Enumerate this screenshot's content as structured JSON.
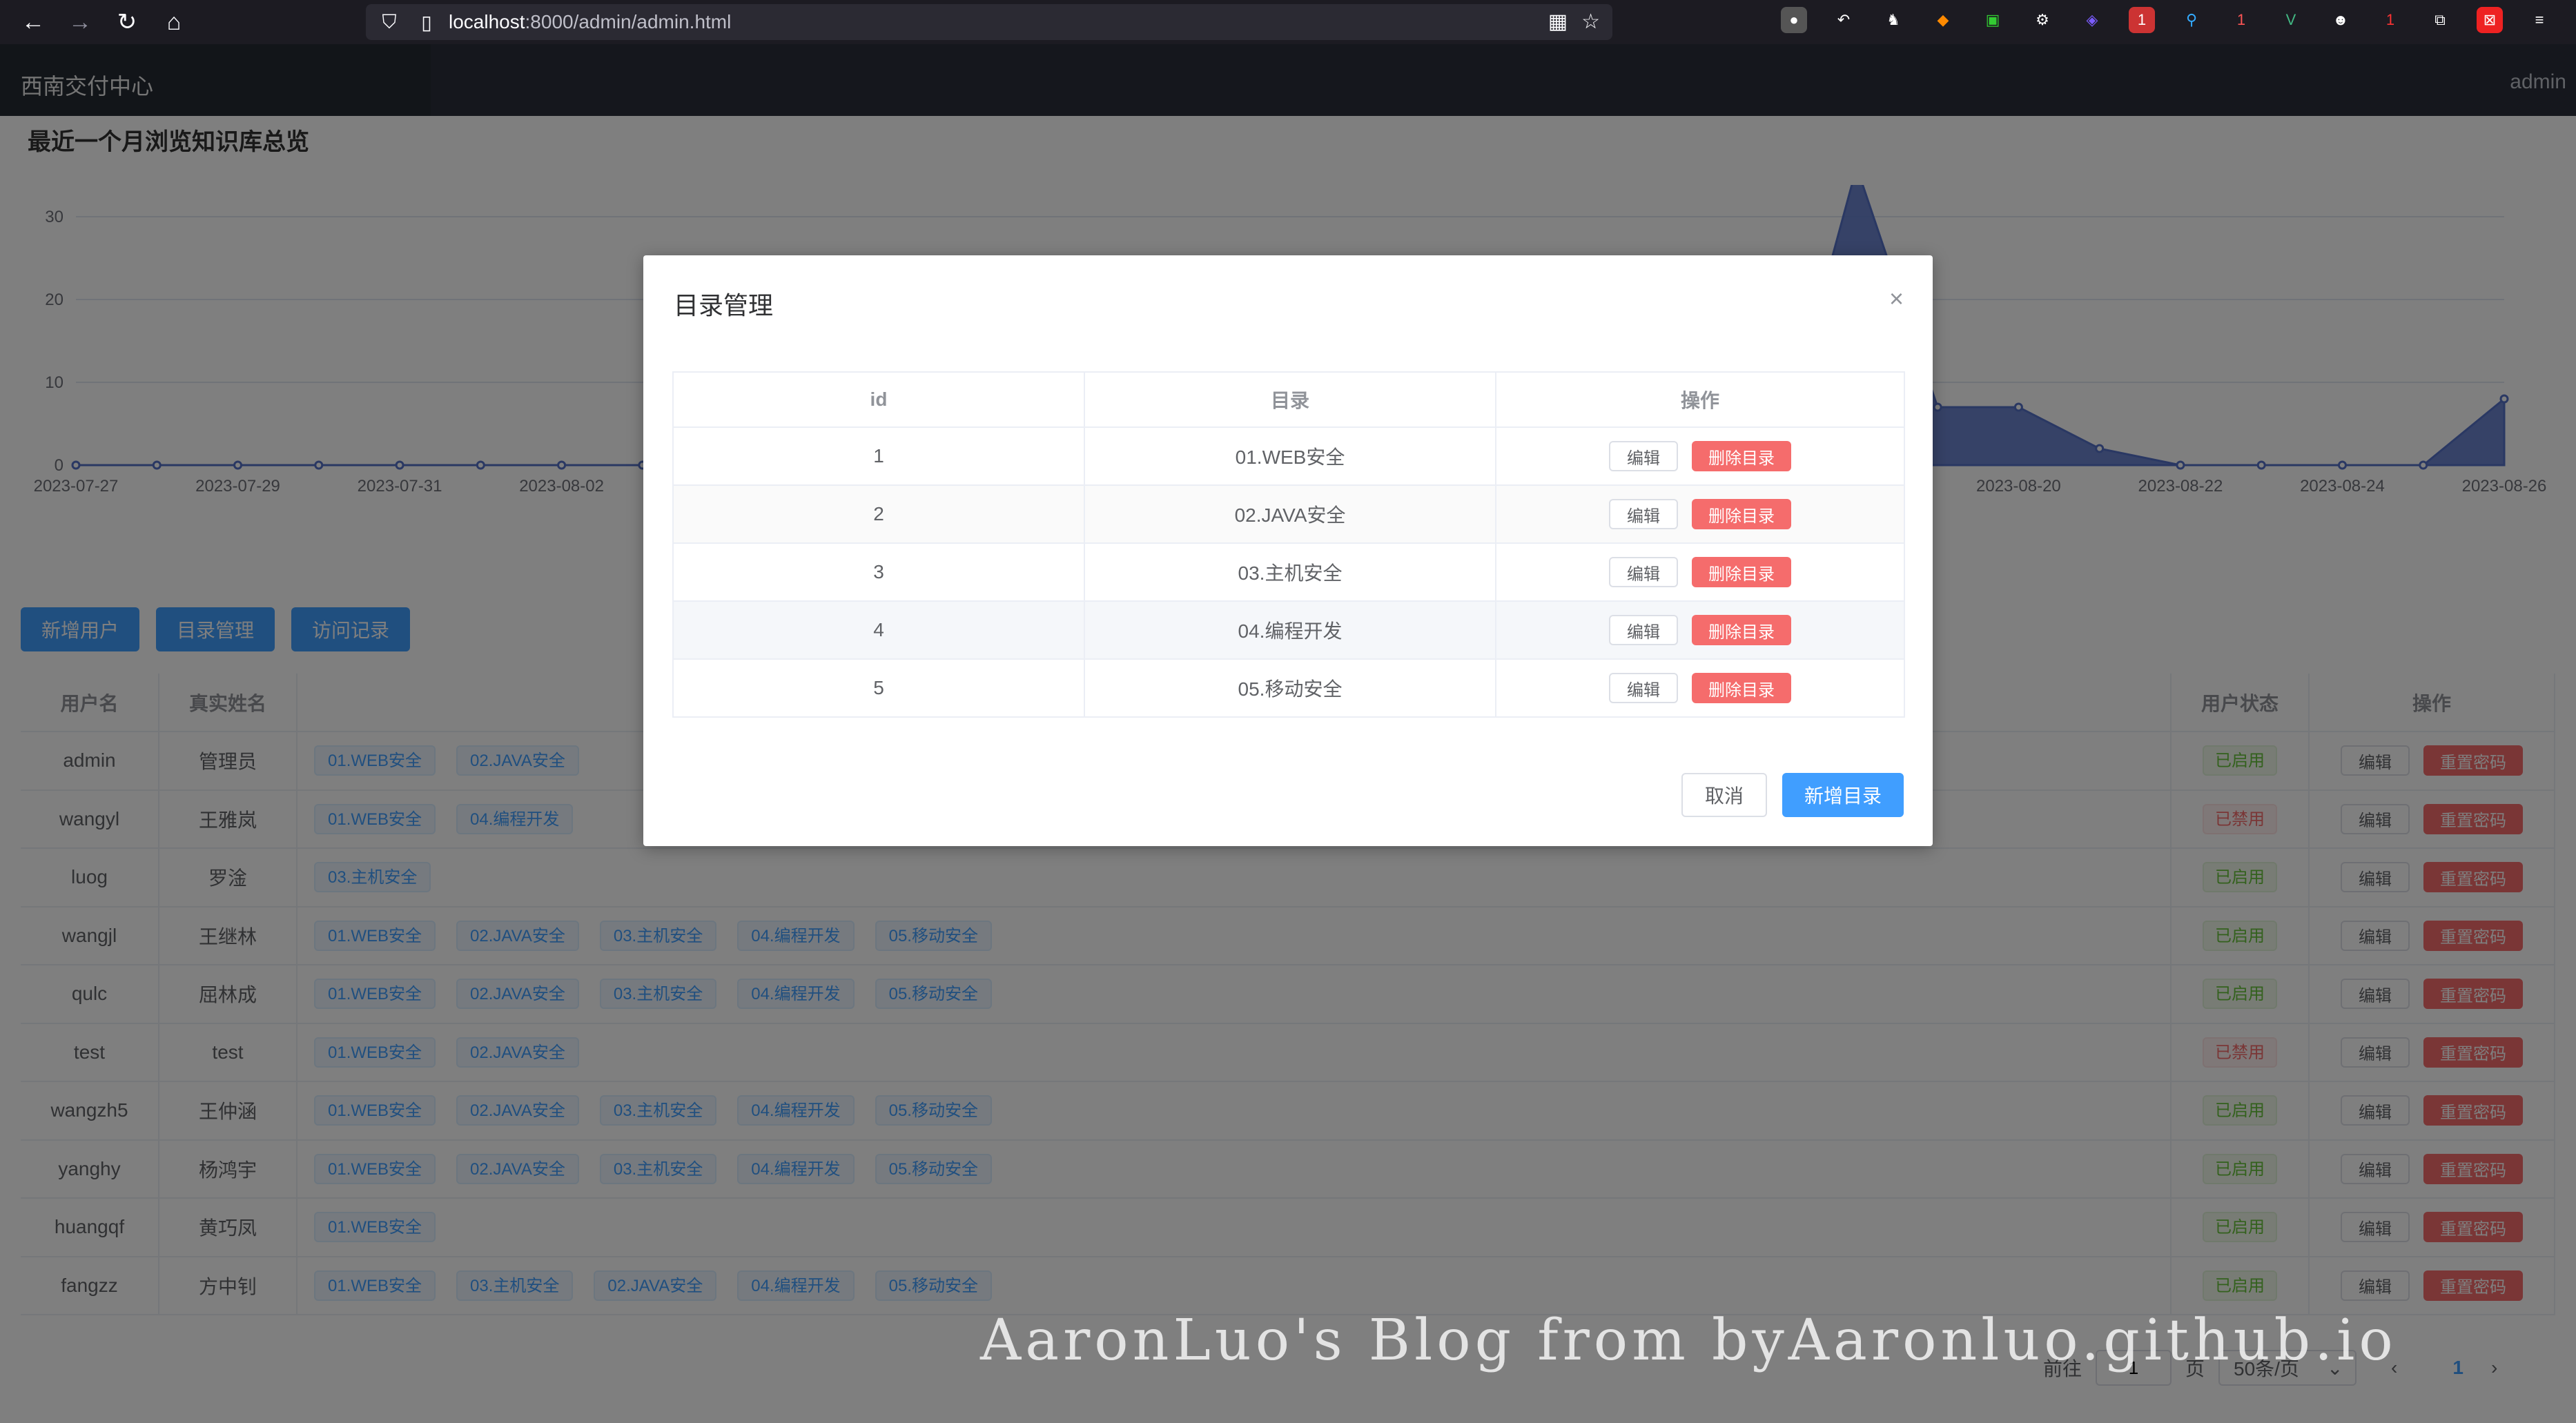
{
  "browser": {
    "url_host": "localhost",
    "url_rest": ":8000/admin/admin.html",
    "extension_badges": [
      "1",
      "1",
      "1"
    ]
  },
  "app": {
    "brand": "西南交付中心",
    "user": "admin"
  },
  "chart_data": {
    "type": "area",
    "title": "最近一个月浏览知识库总览",
    "ylim": [
      0,
      40
    ],
    "yticks": [
      "0",
      "10",
      "20",
      "30",
      "40"
    ],
    "x": [
      "2023-07-27",
      "2023-07-28",
      "2023-07-29",
      "2023-07-30",
      "2023-07-31",
      "2023-08-01",
      "2023-08-02",
      "2023-08-03",
      "2023-08-04",
      "2023-08-05",
      "2023-08-06",
      "2023-08-07",
      "2023-08-08",
      "2023-08-09",
      "2023-08-10",
      "2023-08-11",
      "2023-08-12",
      "2023-08-13",
      "2023-08-14",
      "2023-08-15",
      "2023-08-16",
      "2023-08-17",
      "2023-08-18",
      "2023-08-19",
      "2023-08-20",
      "2023-08-21",
      "2023-08-22",
      "2023-08-23",
      "2023-08-24",
      "2023-08-25",
      "2023-08-26"
    ],
    "xtick_labels": [
      "2023-07-27",
      "2023-07-29",
      "2023-07-31",
      "2023-08-02",
      "2023-08-20",
      "2023-08-22",
      "2023-08-24",
      "2023-08-26"
    ],
    "values": [
      0,
      0,
      0,
      0,
      0,
      0,
      0,
      0,
      0,
      0,
      0,
      0,
      0,
      0,
      0,
      0,
      0,
      0,
      0,
      0,
      0,
      0,
      36,
      7,
      7,
      2,
      0,
      0,
      0,
      0,
      8
    ],
    "color": "#5470c6",
    "grid": true
  },
  "actions": {
    "add_user": "新增用户",
    "dir_manage": "目录管理",
    "visit_log": "访问记录"
  },
  "users_table": {
    "headers": {
      "username": "用户名",
      "realname": "真实姓名",
      "status": "用户状态",
      "ops": "操作"
    },
    "edit_label": "编辑",
    "reset_label": "重置密码",
    "rows": [
      {
        "username": "admin",
        "realname": "管理员",
        "dirs": [
          "01.WEB安全",
          "02.JAVA安全"
        ],
        "status": "已启用",
        "enabled": true
      },
      {
        "username": "wangyl",
        "realname": "王雅岚",
        "dirs": [
          "01.WEB安全",
          "04.编程开发"
        ],
        "status": "已禁用",
        "enabled": false
      },
      {
        "username": "luog",
        "realname": "罗淦",
        "dirs": [
          "03.主机安全"
        ],
        "status": "已启用",
        "enabled": true
      },
      {
        "username": "wangjl",
        "realname": "王继林",
        "dirs": [
          "01.WEB安全",
          "02.JAVA安全",
          "03.主机安全",
          "04.编程开发",
          "05.移动安全"
        ],
        "status": "已启用",
        "enabled": true
      },
      {
        "username": "qulc",
        "realname": "屈林成",
        "dirs": [
          "01.WEB安全",
          "02.JAVA安全",
          "03.主机安全",
          "04.编程开发",
          "05.移动安全"
        ],
        "status": "已启用",
        "enabled": true
      },
      {
        "username": "test",
        "realname": "test",
        "dirs": [
          "01.WEB安全",
          "02.JAVA安全"
        ],
        "status": "已禁用",
        "enabled": false
      },
      {
        "username": "wangzh5",
        "realname": "王仲涵",
        "dirs": [
          "01.WEB安全",
          "02.JAVA安全",
          "03.主机安全",
          "04.编程开发",
          "05.移动安全"
        ],
        "status": "已启用",
        "enabled": true
      },
      {
        "username": "yanghy",
        "realname": "杨鸿宇",
        "dirs": [
          "01.WEB安全",
          "02.JAVA安全",
          "03.主机安全",
          "04.编程开发",
          "05.移动安全"
        ],
        "status": "已启用",
        "enabled": true
      },
      {
        "username": "huangqf",
        "realname": "黄巧凤",
        "dirs": [
          "01.WEB安全"
        ],
        "status": "已启用",
        "enabled": true
      },
      {
        "username": "fangzz",
        "realname": "方中钊",
        "dirs": [
          "01.WEB安全",
          "03.主机安全",
          "02.JAVA安全",
          "04.编程开发",
          "05.移动安全"
        ],
        "status": "已启用",
        "enabled": true
      }
    ]
  },
  "pagination": {
    "goto_label": "前往",
    "page_value": "1",
    "page_unit": "页",
    "page_size": "50条/页",
    "current_page": "1"
  },
  "dialog": {
    "title": "目录管理",
    "close_icon": "×",
    "headers": {
      "id": "id",
      "dir": "目录",
      "ops": "操作"
    },
    "edit_label": "编辑",
    "delete_label": "删除目录",
    "rows": [
      {
        "id": "1",
        "dir": "01.WEB安全"
      },
      {
        "id": "2",
        "dir": "02.JAVA安全"
      },
      {
        "id": "3",
        "dir": "03.主机安全"
      },
      {
        "id": "4",
        "dir": "04.编程开发"
      },
      {
        "id": "5",
        "dir": "05.移动安全"
      }
    ],
    "cancel": "取消",
    "add": "新增目录"
  },
  "watermark": "AaronLuo's Blog from byAaronluo.github.io"
}
